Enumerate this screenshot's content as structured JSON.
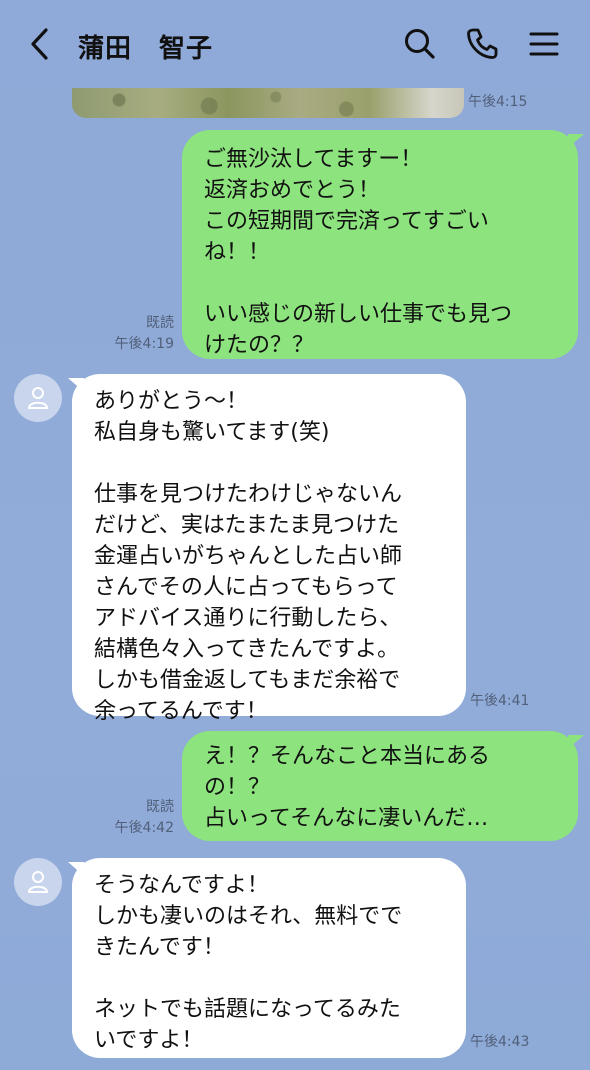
{
  "header": {
    "title": "蒲田　智子",
    "back_icon": "chevron-left-icon",
    "search_icon": "search-icon",
    "call_icon": "phone-icon",
    "menu_icon": "menu-icon"
  },
  "colors": {
    "background": "#8fa9d8",
    "sent_bubble": "#8de37d",
    "received_bubble": "#ffffff"
  },
  "messages": [
    {
      "type": "image",
      "time": "午後4:15"
    },
    {
      "type": "sent",
      "text": "ご無沙汰してますー！\n返済おめでとう！\nこの短期間で完済ってすごい\nね！！\n\nいい感じの新しい仕事でも見つ\nけたの？？",
      "read": "既読",
      "time": "午後4:19"
    },
    {
      "type": "received",
      "text": "ありがとう～！\n私自身も驚いてます(笑)\n\n仕事を見つけたわけじゃないん\nだけど、実はたまたま見つけた\n金運占いがちゃんとした占い師\nさんでその人に占ってもらって\nアドバイス通りに行動したら、\n結構色々入ってきたんですよ。\nしかも借金返してもまだ余裕で\n余ってるんです！",
      "time": "午後4:41"
    },
    {
      "type": "sent",
      "text": "え！？そんなこと本当にある\nの！？\n占いってそんなに凄いんだ…",
      "read": "既読",
      "time": "午後4:42"
    },
    {
      "type": "received",
      "text": "そうなんですよ！\nしかも凄いのはそれ、無料でで\nきたんです！\n\nネットでも話題になってるみた\nいですよ！",
      "time": "午後4:43"
    }
  ]
}
